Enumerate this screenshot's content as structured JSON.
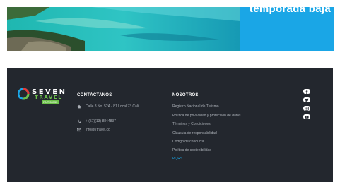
{
  "hero": {
    "banner_text": "temporada baja",
    "banner_color": "#1aa6e6"
  },
  "brand": {
    "name": "SEVEN",
    "sub": "TRAVEL",
    "tag": "RNT 33735",
    "green": "#6cc04a"
  },
  "contact": {
    "title": "CONTÁCTANOS",
    "address": "Calle 8 No. 52A - 81 Local 73 Cali",
    "phone": "+ (57)(13) 8844837",
    "email": "info@7travel.co",
    "icons": [
      "home-icon",
      "phone-icon",
      "mail-icon"
    ]
  },
  "nosotros": {
    "title": "NOSOTROS",
    "items": [
      "Registro Nacional de Turismo",
      "Política de privacidad y protección de datos",
      "Términos y Condiciones",
      "Cláusula de responsabilidad",
      "Código de conducta",
      "Política de sostenibilidad",
      "PQRS"
    ]
  },
  "social": [
    "facebook-icon",
    "twitter-icon",
    "instagram-icon",
    "youtube-icon"
  ],
  "colors": {
    "footer_bg": "#23272e",
    "text_muted": "#a9aeb5",
    "accent": "#1aa6e6"
  }
}
